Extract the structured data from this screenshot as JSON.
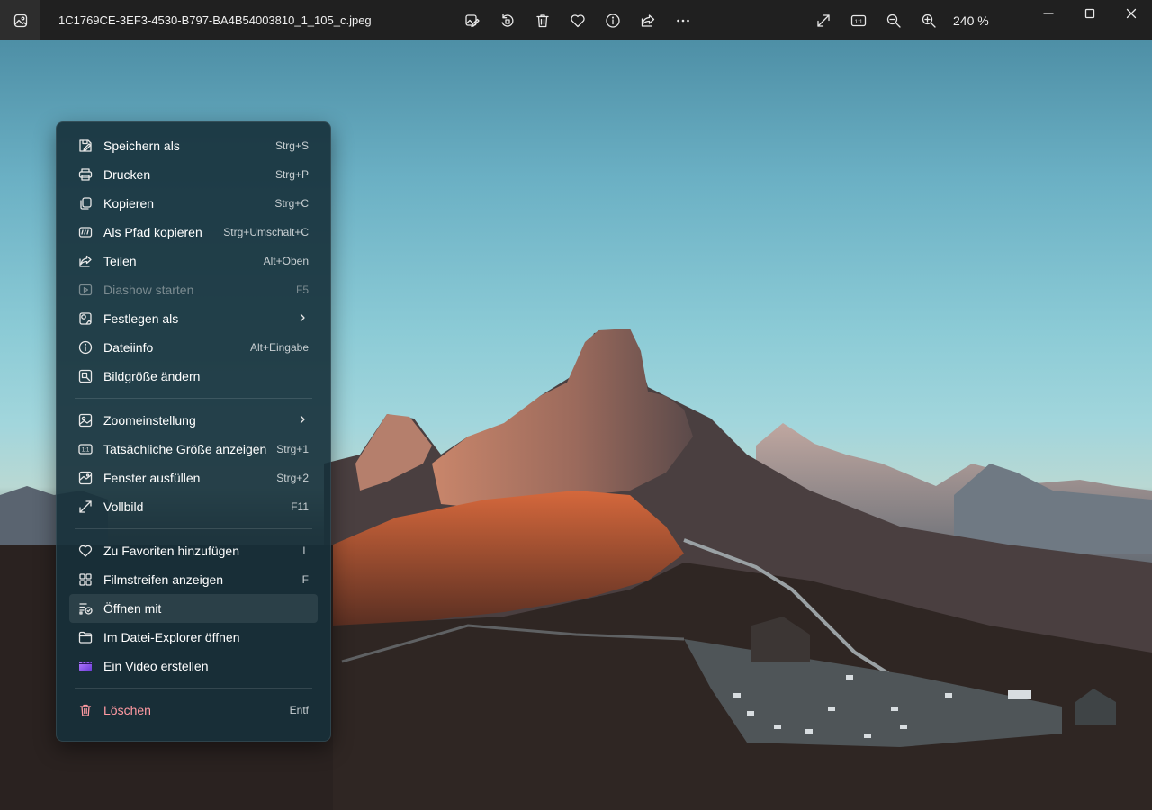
{
  "titlebar": {
    "filename": "1C1769CE-3EF3-4530-B797-BA4B54003810_1_105_c.jpeg",
    "zoom": "240 %",
    "icons": [
      "edit-image-icon",
      "rotate-icon",
      "delete-icon",
      "favorite-icon",
      "info-icon",
      "share-icon",
      "more-icon",
      "fullscreen-icon",
      "actual-size-icon",
      "zoom-out-icon",
      "zoom-in-icon"
    ],
    "actual_size_label": "1:1"
  },
  "menu": {
    "group1": [
      {
        "label": "Speichern als",
        "shortcut": "Strg+S",
        "icon": "save-as-icon"
      },
      {
        "label": "Drucken",
        "shortcut": "Strg+P",
        "icon": "print-icon"
      },
      {
        "label": "Kopieren",
        "shortcut": "Strg+C",
        "icon": "copy-icon"
      },
      {
        "label": "Als Pfad kopieren",
        "shortcut": "Strg+Umschalt+C",
        "icon": "copy-path-icon"
      },
      {
        "label": "Teilen",
        "shortcut": "Alt+Oben",
        "icon": "share-icon"
      },
      {
        "label": "Diashow starten",
        "shortcut": "F5",
        "icon": "slideshow-icon",
        "disabled": true
      },
      {
        "label": "Festlegen als",
        "shortcut": "",
        "icon": "set-as-icon",
        "submenu": true
      },
      {
        "label": "Dateiinfo",
        "shortcut": "Alt+Eingabe",
        "icon": "info-icon"
      },
      {
        "label": "Bildgröße ändern",
        "shortcut": "",
        "icon": "resize-icon"
      }
    ],
    "group2": [
      {
        "label": "Zoomeinstellung",
        "shortcut": "",
        "icon": "zoom-setting-icon",
        "submenu": true
      },
      {
        "label": "Tatsächliche Größe anzeigen",
        "shortcut": "Strg+1",
        "icon": "actual-size-icon"
      },
      {
        "label": "Fenster ausfüllen",
        "shortcut": "Strg+2",
        "icon": "fill-window-icon"
      },
      {
        "label": "Vollbild",
        "shortcut": "F11",
        "icon": "fullscreen-icon"
      }
    ],
    "group3": [
      {
        "label": "Zu Favoriten hinzufügen",
        "shortcut": "L",
        "icon": "heart-icon"
      },
      {
        "label": "Filmstreifen anzeigen",
        "shortcut": "F",
        "icon": "filmstrip-icon"
      },
      {
        "label": "Öffnen mit",
        "shortcut": "",
        "icon": "open-with-icon",
        "hover": true
      },
      {
        "label": "Im Datei-Explorer öffnen",
        "shortcut": "",
        "icon": "folder-icon"
      },
      {
        "label": "Ein Video erstellen",
        "shortcut": "",
        "icon": "video-editor-icon"
      }
    ],
    "group4": [
      {
        "label": "Löschen",
        "shortcut": "Entf",
        "icon": "trash-icon",
        "danger": true
      }
    ]
  },
  "colors": {
    "titlebar_bg": "#202020",
    "menu_bg": "#16303a",
    "danger": "#ff9aa2",
    "disabled": "#7b8b90"
  }
}
